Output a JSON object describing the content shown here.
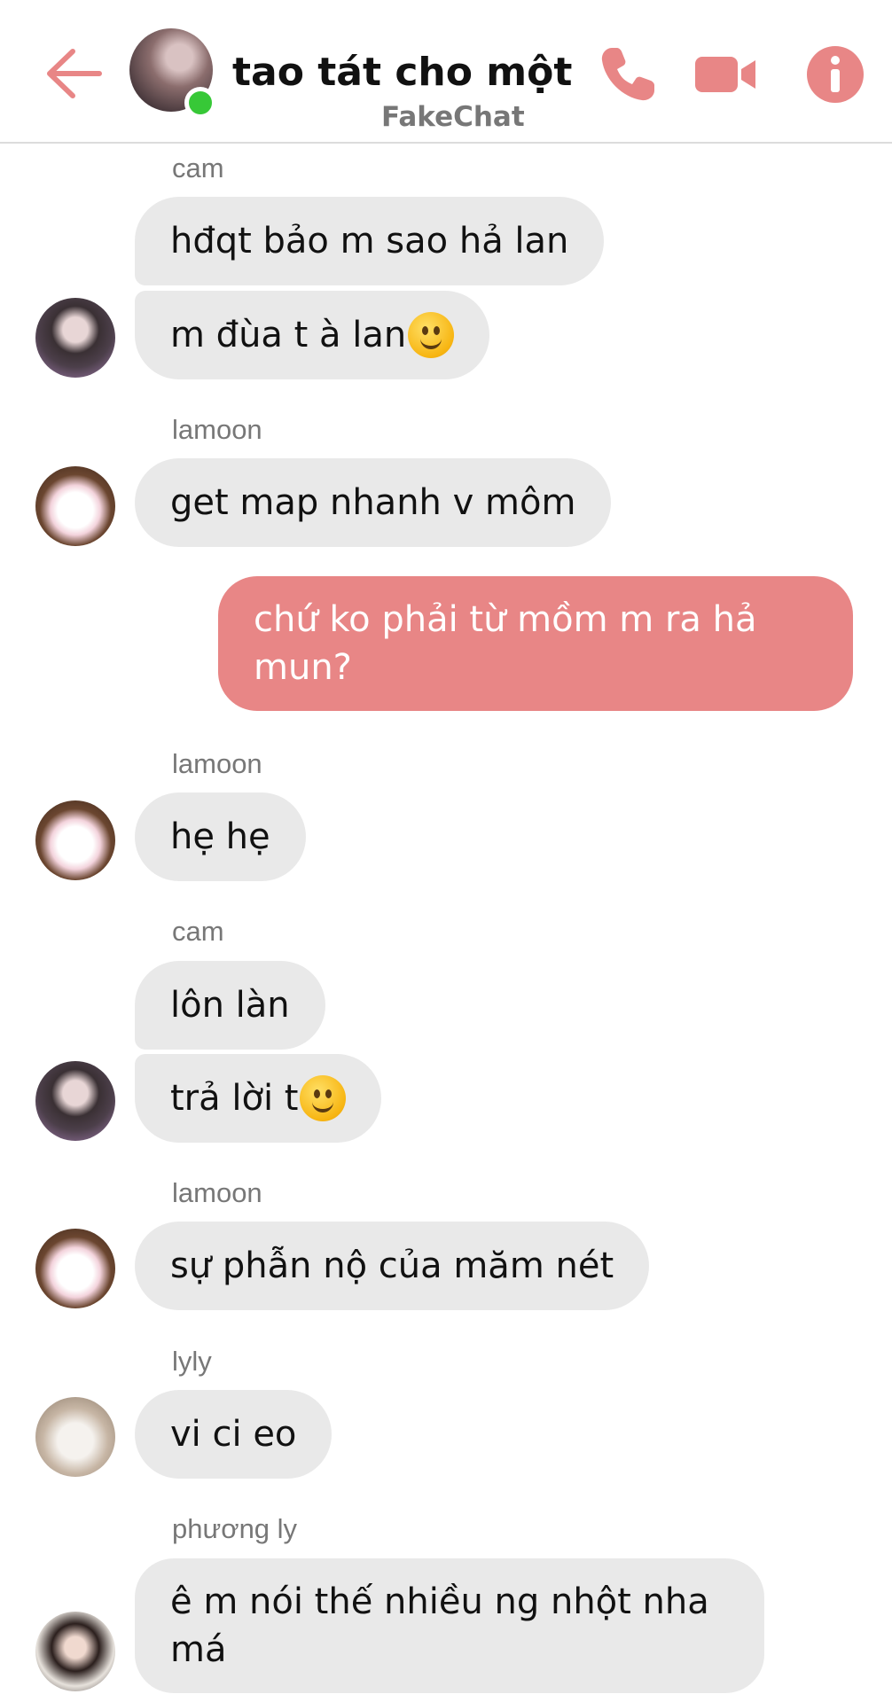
{
  "header": {
    "title": "tao tát cho một ...",
    "subtitle": "FakeChat",
    "accent_color": "#e88686",
    "online_color": "#37c837",
    "icons": [
      "back-arrow-icon",
      "phone-icon",
      "video-camera-icon",
      "info-icon"
    ]
  },
  "messages": [
    {
      "sender": "cam",
      "text": "hđqt bảo m sao hả lan"
    },
    {
      "text": "m đùa t à lan",
      "emoji": "slightly-smiling-face"
    },
    {
      "sender": "lamoon",
      "text": "get map nhanh v môm"
    },
    {
      "text": "chứ ko phải từ mồm m ra hả mun?",
      "outgoing": true
    },
    {
      "sender": "lamoon",
      "text": "hẹ hẹ"
    },
    {
      "sender": "cam",
      "text": "lôn làn"
    },
    {
      "text": "trả lời t",
      "emoji": "slightly-smiling-face"
    },
    {
      "sender": "lamoon",
      "text": "sự phẫn nộ của măm nét"
    },
    {
      "sender": "lyly",
      "text": "vi ci eo"
    },
    {
      "sender": "phương ly",
      "text": "ê m nói thế nhiều ng nhột nha má"
    }
  ]
}
